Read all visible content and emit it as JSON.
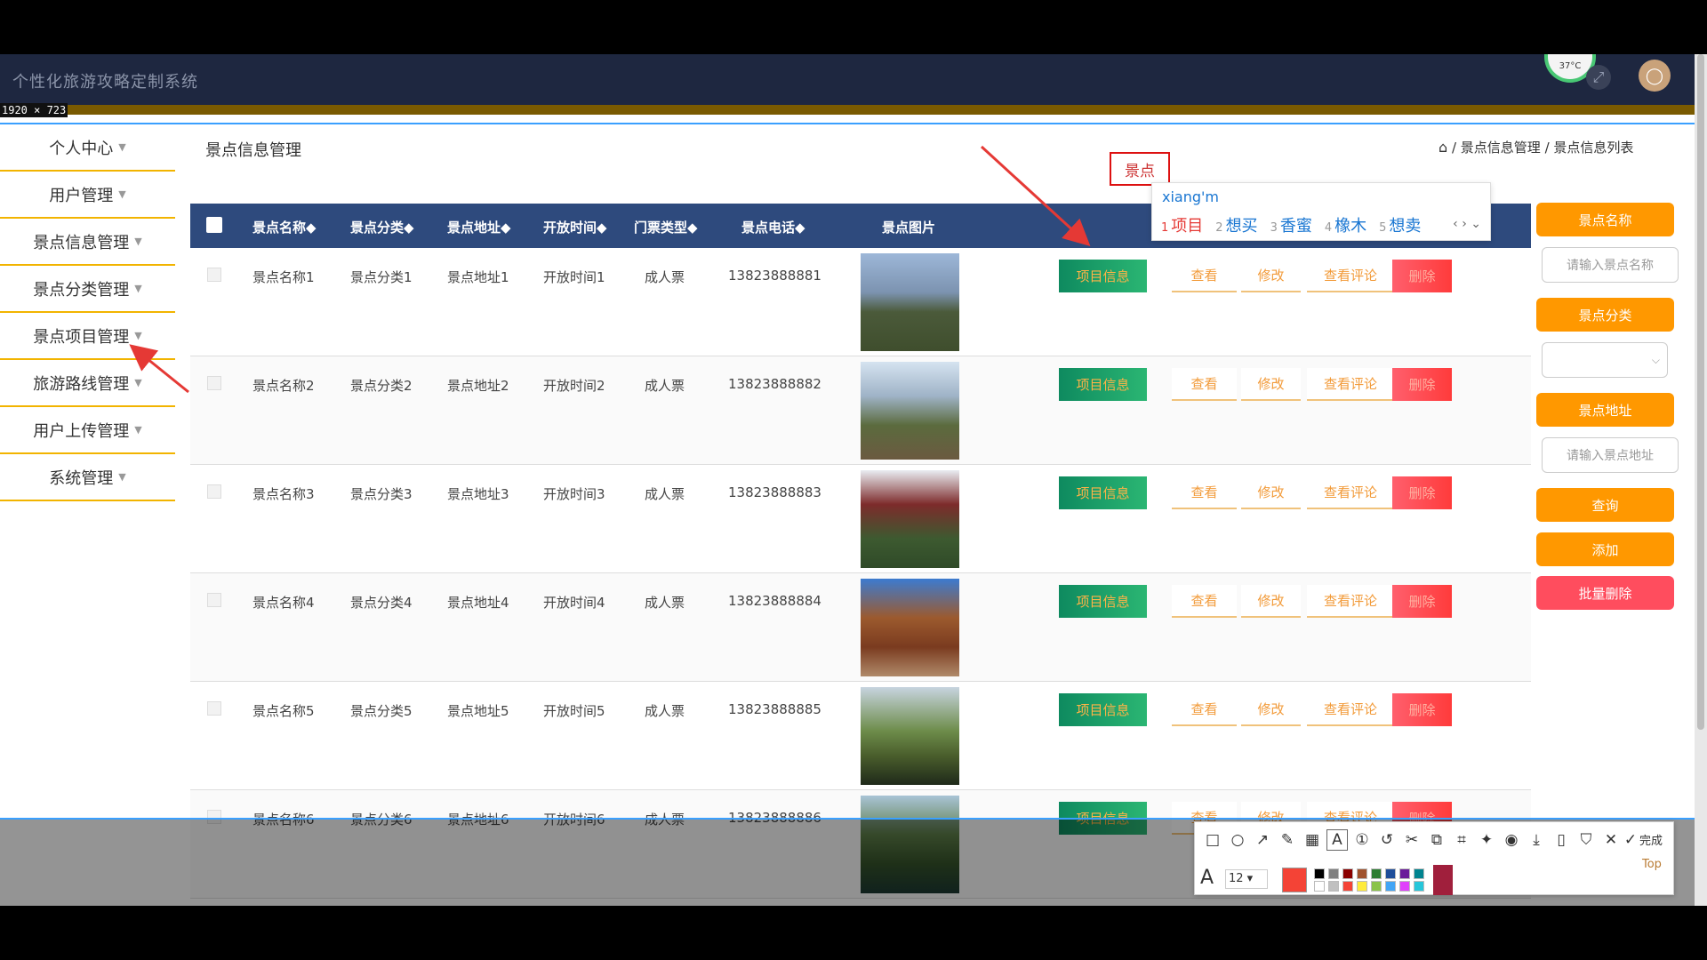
{
  "app": {
    "title": "个性化旅游攻略定制系统",
    "dimension_label": "1920 × 723",
    "temp_badge": "37°C"
  },
  "sidebar": {
    "items": [
      {
        "label": "个人中心"
      },
      {
        "label": "用户管理"
      },
      {
        "label": "景点信息管理"
      },
      {
        "label": "景点分类管理"
      },
      {
        "label": "景点项目管理"
      },
      {
        "label": "旅游路线管理"
      },
      {
        "label": "用户上传管理"
      },
      {
        "label": "系统管理"
      }
    ]
  },
  "page": {
    "title": "景点信息管理",
    "breadcrumb": {
      "sep": "/",
      "level1": "景点信息管理",
      "level2": "景点信息列表"
    }
  },
  "table": {
    "headers": [
      "景点名称◆",
      "景点分类◆",
      "景点地址◆",
      "开放时间◆",
      "门票类型◆",
      "景点电话◆",
      "景点图片"
    ],
    "rows": [
      {
        "name": "景点名称1",
        "category": "景点分类1",
        "address": "景点地址1",
        "open": "开放时间1",
        "ticket": "成人票",
        "phone": "13823888881"
      },
      {
        "name": "景点名称2",
        "category": "景点分类2",
        "address": "景点地址2",
        "open": "开放时间2",
        "ticket": "成人票",
        "phone": "13823888882"
      },
      {
        "name": "景点名称3",
        "category": "景点分类3",
        "address": "景点地址3",
        "open": "开放时间3",
        "ticket": "成人票",
        "phone": "13823888883"
      },
      {
        "name": "景点名称4",
        "category": "景点分类4",
        "address": "景点地址4",
        "open": "开放时间4",
        "ticket": "成人票",
        "phone": "13823888884"
      },
      {
        "name": "景点名称5",
        "category": "景点分类5",
        "address": "景点地址5",
        "open": "开放时间5",
        "ticket": "成人票",
        "phone": "13823888885"
      },
      {
        "name": "景点名称6",
        "category": "景点分类6",
        "address": "景点地址6",
        "open": "开放时间6",
        "ticket": "成人票",
        "phone": "13823888886"
      }
    ],
    "actions": {
      "project": "项目信息",
      "view": "查看",
      "edit": "修改",
      "comments": "查看评论",
      "delete": "删除"
    }
  },
  "search_panel": {
    "name_label": "景点名称",
    "name_placeholder": "请输入景点名称",
    "category_label": "景点分类",
    "category_value": "",
    "address_label": "景点地址",
    "address_placeholder": "请输入景点地址",
    "query_button": "查询",
    "add_button": "添加",
    "batch_delete_button": "批量删除"
  },
  "ime": {
    "typed_box": "景点",
    "composition": "xiang'm",
    "candidates": [
      {
        "n": "1",
        "text": "项目"
      },
      {
        "n": "2",
        "text": "想买"
      },
      {
        "n": "3",
        "text": "香蜜"
      },
      {
        "n": "4",
        "text": "橡木"
      },
      {
        "n": "5",
        "text": "想卖"
      }
    ]
  },
  "annot_toolbar": {
    "font_size": "12",
    "done_label": "完成",
    "current_color": "#f44336"
  },
  "top_link": "Top",
  "colors": {
    "header_bg": "#1e2740",
    "table_head": "#2e4a7d",
    "accent": "#ff9800",
    "menu_rule": "#f2b400"
  }
}
